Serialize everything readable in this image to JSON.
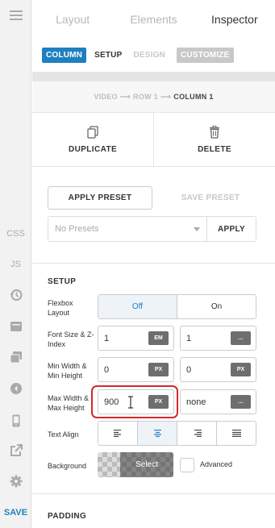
{
  "tabs": [
    {
      "label": "Layout"
    },
    {
      "label": "Elements"
    },
    {
      "label": "Inspector"
    }
  ],
  "subtabs": {
    "column": "COLUMN",
    "setup": "SETUP",
    "design": "DESIGN",
    "customize": "CUSTOMIZE"
  },
  "breadcrumb": {
    "video": "VIDEO",
    "row": "ROW 1",
    "column": "COLUMN 1",
    "arrow": "⟶"
  },
  "actions": {
    "duplicate": "DUPLICATE",
    "delete": "DELETE"
  },
  "presets": {
    "apply_preset": "APPLY PRESET",
    "save_preset": "SAVE PRESET",
    "select_value": "No Presets",
    "apply": "APPLY"
  },
  "rail": {
    "css": "CSS",
    "js": "JS",
    "save": "SAVE"
  },
  "setup": {
    "title": "SETUP",
    "flexbox_label": "Flexbox Layout",
    "flexbox_off": "Off",
    "flexbox_on": "On",
    "font_size_label": "Font Size & Z-Index",
    "font_size_value": "1",
    "font_size_unit": "EM",
    "z_index_value": "1",
    "z_index_unit": "…",
    "min_label": "Min Width & Min Height",
    "min_width_value": "0",
    "min_width_unit": "PX",
    "min_height_value": "0",
    "min_height_unit": "PX",
    "max_label": "Max Width & Max Height",
    "max_width_value": "900",
    "max_width_unit": "PX",
    "max_height_value": "none",
    "max_height_unit": "…",
    "text_align_label": "Text Align",
    "background_label": "Background",
    "background_select": "Select",
    "advanced_label": "Advanced"
  },
  "padding": {
    "title": "PADDING"
  },
  "colors": {
    "accent": "#1f7fbf",
    "highlight": "#d9262b"
  }
}
